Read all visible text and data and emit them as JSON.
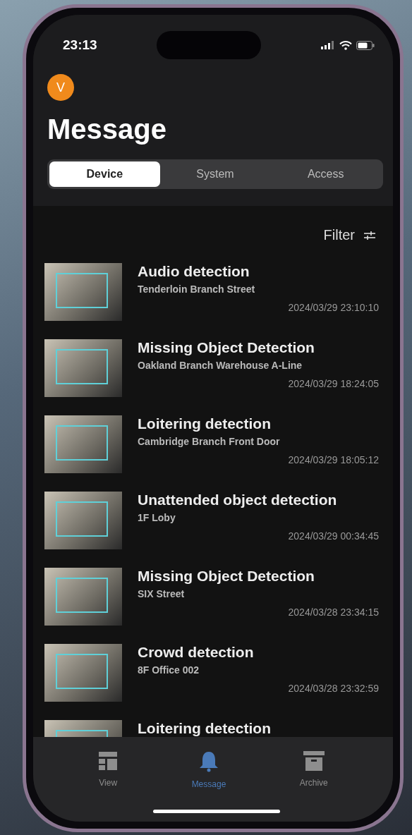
{
  "status_bar": {
    "time": "23:13"
  },
  "avatar": {
    "initial": "V"
  },
  "title": "Message",
  "tabs": [
    {
      "label": "Device",
      "selected": true
    },
    {
      "label": "System",
      "selected": false
    },
    {
      "label": "Access",
      "selected": false
    }
  ],
  "filter": {
    "label": "Filter"
  },
  "messages": [
    {
      "title": "Audio detection",
      "location": "Tenderloin Branch Street",
      "time": "2024/03/29 23:10:10"
    },
    {
      "title": "Missing Object Detection",
      "location": "Oakland Branch Warehouse A-Line",
      "time": "2024/03/29 18:24:05"
    },
    {
      "title": "Loitering detection",
      "location": "Cambridge Branch Front Door",
      "time": "2024/03/29 18:05:12"
    },
    {
      "title": "Unattended object detection",
      "location": "1F Loby",
      "time": "2024/03/29 00:34:45"
    },
    {
      "title": "Missing Object Detection",
      "location": "SIX Street",
      "time": "2024/03/28 23:34:15"
    },
    {
      "title": "Crowd detection",
      "location": "8F Office 002",
      "time": "2024/03/28 23:32:59"
    },
    {
      "title": "Loitering detection"
    }
  ],
  "nav": [
    {
      "label": "View",
      "kind": "view",
      "selected": false
    },
    {
      "label": "Message",
      "kind": "message",
      "selected": true
    },
    {
      "label": "Archive",
      "kind": "archive",
      "selected": false
    }
  ]
}
